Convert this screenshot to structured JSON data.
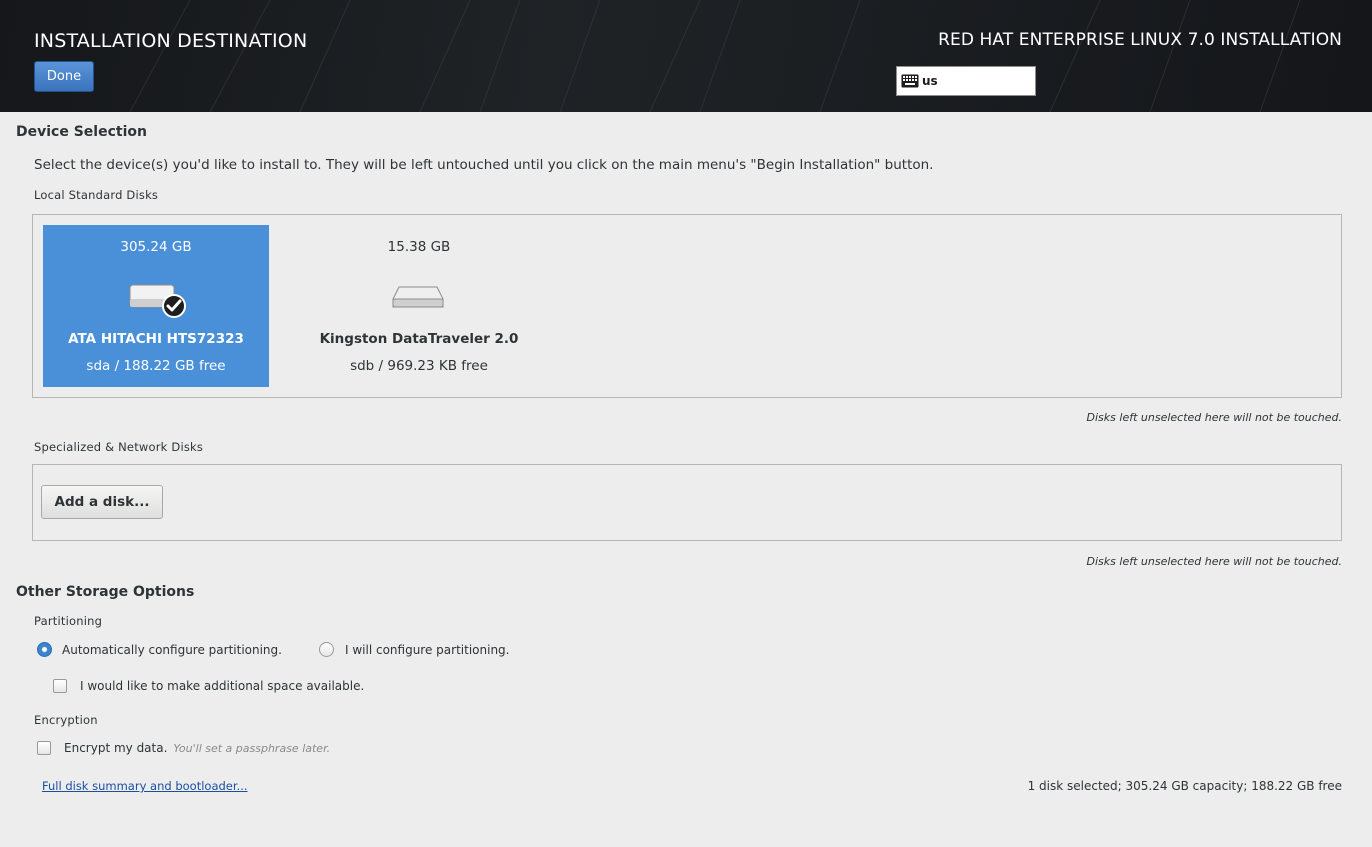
{
  "header": {
    "title": "INSTALLATION DESTINATION",
    "done_label": "Done",
    "product": "RED HAT ENTERPRISE LINUX 7.0 INSTALLATION",
    "keyboard_layout": "us"
  },
  "device_selection": {
    "title": "Device Selection",
    "instructions": "Select the device(s) you'd like to install to.  They will be left untouched until you click on the main menu's \"Begin Installation\" button.",
    "local_label": "Local Standard Disks",
    "disks": [
      {
        "capacity": "305.24 GB",
        "name": "ATA HITACHI HTS72323",
        "info": "sda  /  188.22 GB free",
        "selected": true
      },
      {
        "capacity": "15.38 GB",
        "name": "Kingston DataTraveler 2.0",
        "info": "sdb  /  969.23 KB free",
        "selected": false
      }
    ],
    "local_note": "Disks left unselected here will not be touched.",
    "specialized_label": "Specialized & Network Disks",
    "add_disk_label": "Add a disk...",
    "specialized_note": "Disks left unselected here will not be touched."
  },
  "other": {
    "title": "Other Storage Options",
    "partitioning_label": "Partitioning",
    "auto_label": "Automatically configure partitioning.",
    "auto_selected": true,
    "manual_label": "I will configure partitioning.",
    "space_label": "I would like to make additional space available.",
    "space_checked": false,
    "encryption_label": "Encryption",
    "encrypt_label": "Encrypt my data.",
    "encrypt_hint": "You'll set a passphrase later.",
    "encrypt_checked": false
  },
  "footer": {
    "summary_link": "Full disk summary and bootloader...",
    "status": "1 disk selected; 305.24 GB capacity; 188.22 GB free"
  },
  "colors": {
    "selected_disk": "#4a90d9",
    "header_bg": "#1b1e21",
    "link": "#1a4fa0"
  }
}
